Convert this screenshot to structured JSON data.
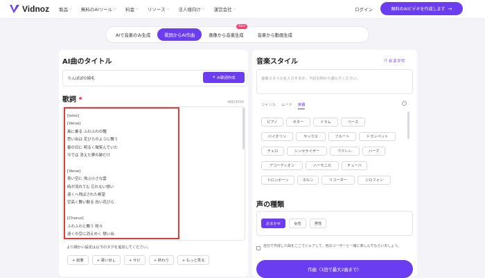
{
  "brand": {
    "name": "Vidnoz",
    "accent": "#6a3df0",
    "highlight": "#e53935"
  },
  "nav": {
    "items": [
      "製品",
      "無料のAIツール",
      "料金",
      "リソース",
      "法人様向け",
      "運営会社"
    ],
    "login": "ログイン",
    "cta": "無料のAIビデオを作成します",
    "cta_icon": "arrow-right-icon"
  },
  "tabs": [
    {
      "label": "AIで音楽のみ生成",
      "active": false
    },
    {
      "label": "歌詞からAI作曲",
      "active": true
    },
    {
      "label": "画像から音楽生成",
      "active": false,
      "badge": "New"
    },
    {
      "label": "音楽から動画生成",
      "active": false
    }
  ],
  "left": {
    "title_heading": "AI曲のタイトル",
    "title_value": "たんぽぽの綿毛",
    "gen_title_button": "AI歌詞作成",
    "lyrics_heading": "歌詞",
    "required_mark": "*",
    "counter": "486/3000",
    "lyrics": "[Intro]\n[Verse]\n風に乗る ふわふわの種\n思い出は 花びらのように舞う\n春の日に 明るく微笑んでいた\n今では 消えた夢の跡だけ\n\n[Verse]\n青い空に 飛ぶ小さな雲\n時が流れても 忘れない想い\n遠くへ飛ばされた希望\n空高く舞い散る 白い花びら\n\n[Chorus]\nふわふわと舞う 柊々\n遠くの空に消えゆく 想い出",
    "tag_hint": "より細かい設定は以下のタグを追加してください。",
    "tags": [
      "+ 前奏",
      "+ 歌い出し",
      "+ サビ",
      "+ 終わり",
      "+ もっと見る"
    ]
  },
  "right": {
    "style_heading": "音楽スタイル",
    "random_label": "おまかせ",
    "random_icon": "shuffle-icon",
    "style_placeholder": "音楽スタイルを入力するか、下記の例から選んでください。",
    "style_tabs": [
      {
        "label": "ジャンル",
        "active": false
      },
      {
        "label": "ムード",
        "active": false
      },
      {
        "label": "楽器",
        "active": true
      }
    ],
    "instrument_rows": [
      [
        "ピアノ",
        "ギター",
        "ドラム",
        "ベース"
      ],
      [
        "バイオリン",
        "サックス",
        "フルート",
        "トランペット"
      ],
      [
        "チェロ",
        "シンセサイザー",
        "ウクレレ",
        "ハープ"
      ],
      [
        "アコーディオン",
        "ハーモニカ",
        "チューバ"
      ],
      [
        "トロンボーン",
        "ホルン",
        "リコーダー",
        "シロフォン"
      ]
    ],
    "voice_heading": "声の種類",
    "voice_options": [
      {
        "label": "おまかせ",
        "active": true
      },
      {
        "label": "女性",
        "active": false
      },
      {
        "label": "男性",
        "active": false
      }
    ],
    "share_text": "自分で作成した曲をここでシェアして、他のユーザーと一緒に楽しんでもらいましょう。",
    "compose_button": "作曲（1回で最大2曲まで）"
  }
}
